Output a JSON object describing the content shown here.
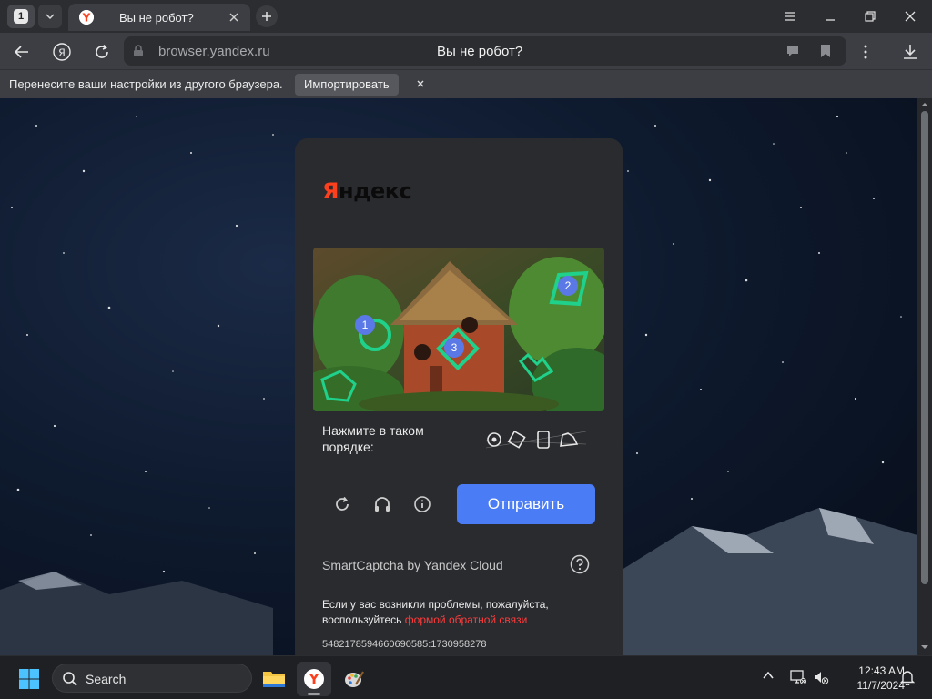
{
  "browser": {
    "tab_count": "1",
    "tab_title": "Вы не робот?",
    "url": "browser.yandex.ru",
    "page_title": "Вы не робот?"
  },
  "infobar": {
    "message": "Перенесите ваши настройки из другого браузера.",
    "import_label": "Импортировать"
  },
  "captcha": {
    "logo_first": "Я",
    "logo_rest": "ндекс",
    "marker_labels": [
      "1",
      "2",
      "3"
    ],
    "instruction": "Нажмите в таком порядке:",
    "submit_label": "Отправить",
    "brand": "SmartCaptcha by Yandex Cloud",
    "problem_text": "Если у вас возникли проблемы, пожалуйста, воспользуйтесь",
    "problem_link": "формой обратной связи",
    "token": "5482178594660690585:1730958278"
  },
  "taskbar": {
    "search_placeholder": "Search",
    "time": "12:43 AM",
    "date": "11/7/2024"
  },
  "colors": {
    "accent": "#4a7cf5",
    "yandex_red": "#fc3f1d",
    "marker_green": "#1fd18a",
    "marker_blue": "#5b79e6"
  }
}
